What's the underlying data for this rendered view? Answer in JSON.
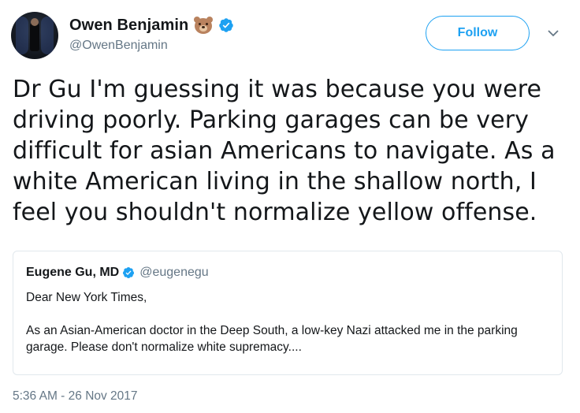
{
  "author": {
    "display_name": "Owen Benjamin",
    "handle": "@OwenBenjamin",
    "emoji_icon": "bear-face-icon",
    "verified": true
  },
  "actions": {
    "follow_label": "Follow",
    "more_icon": "chevron-down-icon"
  },
  "tweet": {
    "text": "Dr Gu I'm guessing it was because you were driving poorly. Parking garages can be very difficult for asian Americans to navigate. As a white American living in the shallow north, I feel you shouldn't normalize yellow offense."
  },
  "quoted_tweet": {
    "display_name": "Eugene Gu, MD",
    "handle": "@eugenegu",
    "verified": true,
    "line1": "Dear New York Times,",
    "line2": "As an Asian-American doctor in the Deep South, a low-key Nazi attacked me in the parking garage. Please don't normalize white supremacy...."
  },
  "timestamp": "5:36 AM - 26 Nov 2017",
  "colors": {
    "accent": "#1da1f2",
    "text": "#14171a",
    "muted": "#657786",
    "border": "#e1e8ed"
  }
}
